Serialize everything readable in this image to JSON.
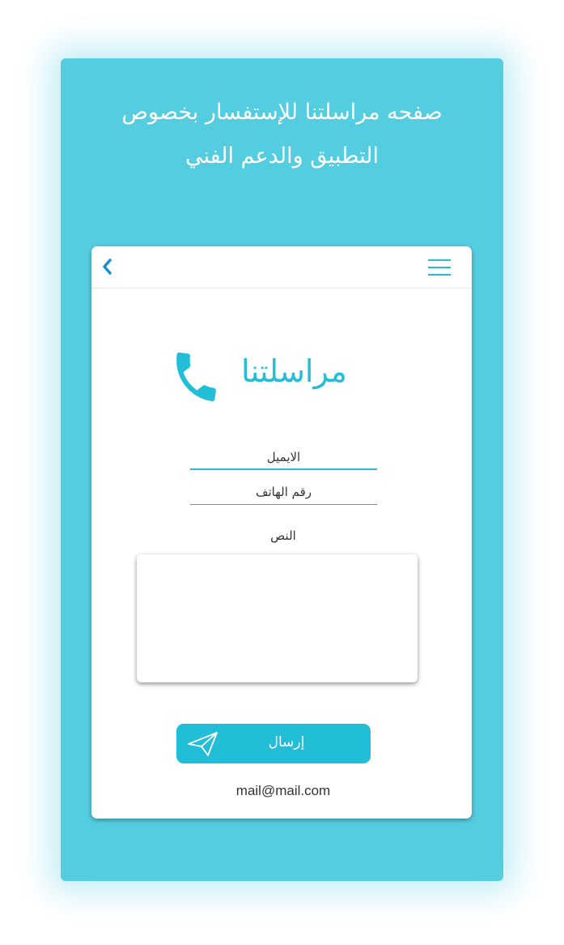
{
  "page": {
    "headline_line1": "صفحه مراسلتنا للإستفسار بخصوص",
    "headline_line2": "التطبيق والدعم الفني"
  },
  "topbar": {
    "back_icon": "chevron-left-icon",
    "menu_icon": "hamburger-menu-icon"
  },
  "contact": {
    "title": "مراسلتنا",
    "title_icon": "phone-icon",
    "email_placeholder": "الايميل",
    "phone_placeholder": "رقم الهاتف",
    "text_label": "النص",
    "message_value": "",
    "send_label": "إرسال",
    "send_icon": "paper-plane-icon",
    "footer_email": "mail@mail.com"
  },
  "colors": {
    "panel_background": "#55cde1",
    "accent": "#22bed8",
    "text": "#333333",
    "white": "#ffffff"
  }
}
